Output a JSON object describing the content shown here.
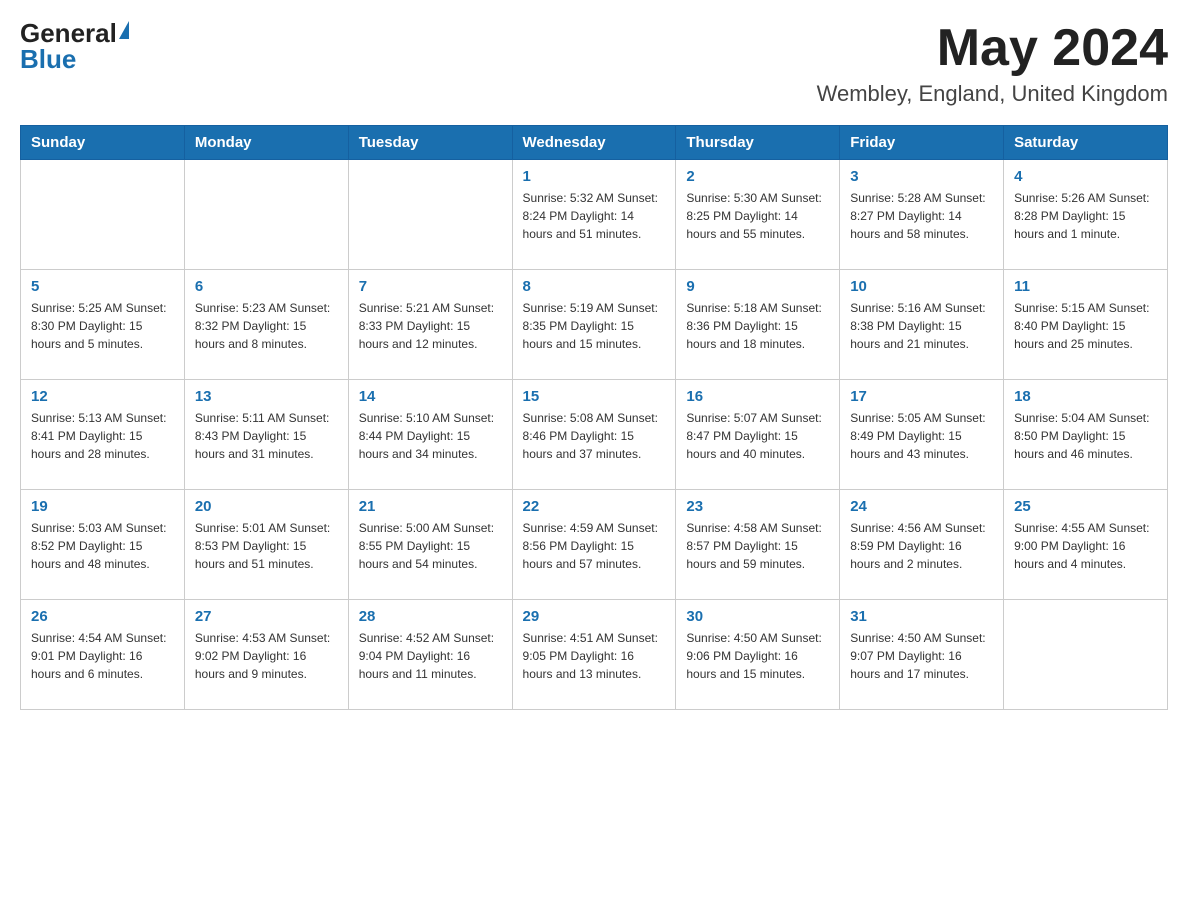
{
  "header": {
    "logo_general": "General",
    "logo_blue": "Blue",
    "month_title": "May 2024",
    "location": "Wembley, England, United Kingdom"
  },
  "weekdays": [
    "Sunday",
    "Monday",
    "Tuesday",
    "Wednesday",
    "Thursday",
    "Friday",
    "Saturday"
  ],
  "weeks": [
    [
      {
        "day": "",
        "info": ""
      },
      {
        "day": "",
        "info": ""
      },
      {
        "day": "",
        "info": ""
      },
      {
        "day": "1",
        "info": "Sunrise: 5:32 AM\nSunset: 8:24 PM\nDaylight: 14 hours and 51 minutes."
      },
      {
        "day": "2",
        "info": "Sunrise: 5:30 AM\nSunset: 8:25 PM\nDaylight: 14 hours and 55 minutes."
      },
      {
        "day": "3",
        "info": "Sunrise: 5:28 AM\nSunset: 8:27 PM\nDaylight: 14 hours and 58 minutes."
      },
      {
        "day": "4",
        "info": "Sunrise: 5:26 AM\nSunset: 8:28 PM\nDaylight: 15 hours and 1 minute."
      }
    ],
    [
      {
        "day": "5",
        "info": "Sunrise: 5:25 AM\nSunset: 8:30 PM\nDaylight: 15 hours and 5 minutes."
      },
      {
        "day": "6",
        "info": "Sunrise: 5:23 AM\nSunset: 8:32 PM\nDaylight: 15 hours and 8 minutes."
      },
      {
        "day": "7",
        "info": "Sunrise: 5:21 AM\nSunset: 8:33 PM\nDaylight: 15 hours and 12 minutes."
      },
      {
        "day": "8",
        "info": "Sunrise: 5:19 AM\nSunset: 8:35 PM\nDaylight: 15 hours and 15 minutes."
      },
      {
        "day": "9",
        "info": "Sunrise: 5:18 AM\nSunset: 8:36 PM\nDaylight: 15 hours and 18 minutes."
      },
      {
        "day": "10",
        "info": "Sunrise: 5:16 AM\nSunset: 8:38 PM\nDaylight: 15 hours and 21 minutes."
      },
      {
        "day": "11",
        "info": "Sunrise: 5:15 AM\nSunset: 8:40 PM\nDaylight: 15 hours and 25 minutes."
      }
    ],
    [
      {
        "day": "12",
        "info": "Sunrise: 5:13 AM\nSunset: 8:41 PM\nDaylight: 15 hours and 28 minutes."
      },
      {
        "day": "13",
        "info": "Sunrise: 5:11 AM\nSunset: 8:43 PM\nDaylight: 15 hours and 31 minutes."
      },
      {
        "day": "14",
        "info": "Sunrise: 5:10 AM\nSunset: 8:44 PM\nDaylight: 15 hours and 34 minutes."
      },
      {
        "day": "15",
        "info": "Sunrise: 5:08 AM\nSunset: 8:46 PM\nDaylight: 15 hours and 37 minutes."
      },
      {
        "day": "16",
        "info": "Sunrise: 5:07 AM\nSunset: 8:47 PM\nDaylight: 15 hours and 40 minutes."
      },
      {
        "day": "17",
        "info": "Sunrise: 5:05 AM\nSunset: 8:49 PM\nDaylight: 15 hours and 43 minutes."
      },
      {
        "day": "18",
        "info": "Sunrise: 5:04 AM\nSunset: 8:50 PM\nDaylight: 15 hours and 46 minutes."
      }
    ],
    [
      {
        "day": "19",
        "info": "Sunrise: 5:03 AM\nSunset: 8:52 PM\nDaylight: 15 hours and 48 minutes."
      },
      {
        "day": "20",
        "info": "Sunrise: 5:01 AM\nSunset: 8:53 PM\nDaylight: 15 hours and 51 minutes."
      },
      {
        "day": "21",
        "info": "Sunrise: 5:00 AM\nSunset: 8:55 PM\nDaylight: 15 hours and 54 minutes."
      },
      {
        "day": "22",
        "info": "Sunrise: 4:59 AM\nSunset: 8:56 PM\nDaylight: 15 hours and 57 minutes."
      },
      {
        "day": "23",
        "info": "Sunrise: 4:58 AM\nSunset: 8:57 PM\nDaylight: 15 hours and 59 minutes."
      },
      {
        "day": "24",
        "info": "Sunrise: 4:56 AM\nSunset: 8:59 PM\nDaylight: 16 hours and 2 minutes."
      },
      {
        "day": "25",
        "info": "Sunrise: 4:55 AM\nSunset: 9:00 PM\nDaylight: 16 hours and 4 minutes."
      }
    ],
    [
      {
        "day": "26",
        "info": "Sunrise: 4:54 AM\nSunset: 9:01 PM\nDaylight: 16 hours and 6 minutes."
      },
      {
        "day": "27",
        "info": "Sunrise: 4:53 AM\nSunset: 9:02 PM\nDaylight: 16 hours and 9 minutes."
      },
      {
        "day": "28",
        "info": "Sunrise: 4:52 AM\nSunset: 9:04 PM\nDaylight: 16 hours and 11 minutes."
      },
      {
        "day": "29",
        "info": "Sunrise: 4:51 AM\nSunset: 9:05 PM\nDaylight: 16 hours and 13 minutes."
      },
      {
        "day": "30",
        "info": "Sunrise: 4:50 AM\nSunset: 9:06 PM\nDaylight: 16 hours and 15 minutes."
      },
      {
        "day": "31",
        "info": "Sunrise: 4:50 AM\nSunset: 9:07 PM\nDaylight: 16 hours and 17 minutes."
      },
      {
        "day": "",
        "info": ""
      }
    ]
  ]
}
